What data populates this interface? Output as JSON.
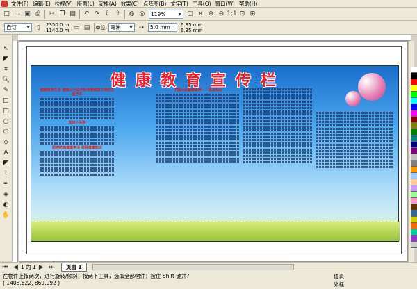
{
  "menu": [
    "文件(F)",
    "编辑(E)",
    "检视(V)",
    "版面(L)",
    "安排(A)",
    "效果(C)",
    "点阵图(B)",
    "文字(T)",
    "工具(O)",
    "窗口(W)",
    "帮助(H)"
  ],
  "toolbar": {
    "zoom_value": "119%",
    "icons": [
      "new-icon",
      "open-icon",
      "save-icon",
      "print-icon",
      "cut-icon",
      "copy-icon",
      "paste-icon",
      "undo-icon",
      "redo-icon",
      "import-icon",
      "export-icon"
    ]
  },
  "propbar": {
    "paper_size": "自订",
    "width": "2350.0 m",
    "height": "1140.0 m",
    "unit": "毫米",
    "nudge": "5.0 mm",
    "dup_x": "6.35 mm",
    "dup_y": "6.35 mm"
  },
  "board": {
    "title": "健康教育宣传栏",
    "left_heading": "健康教育生活 健康从行动开始传播健康文明的生活方式",
    "left_subheading": "知识小问答",
    "left_sub2": "防控防病健康生活 倡导健康知识",
    "mid_heading": "中国公民健康素养——基本知识",
    "columns": 5
  },
  "pager": {
    "position": "1 的 1",
    "tab": "页面 1"
  },
  "status": {
    "message": "在物件上按两次，进行旋转/倾斜；按两下工具，选取全部物件；按住 Shift 键并?",
    "coords": "( 1408.622, 869.992 )",
    "fill_label": "填色",
    "outline_label": "外框"
  },
  "colors": {
    "chrome": "#ece9d8",
    "title_red": "#e8232f",
    "board_blue": "#1a6fcc"
  },
  "palette": [
    "#ffffff",
    "#000000",
    "#ff0000",
    "#ffff00",
    "#00ff00",
    "#00ffff",
    "#0000ff",
    "#ff00ff",
    "#800000",
    "#808000",
    "#008000",
    "#008080",
    "#000080",
    "#800080",
    "#c0c0c0",
    "#808080",
    "#ff9900",
    "#99ccff",
    "#ffcc99",
    "#cc99ff",
    "#99ff99",
    "#ff99cc",
    "#663300",
    "#336699",
    "#cccc00",
    "#ff6600",
    "#00cc99",
    "#9933cc",
    "#cccccc"
  ]
}
